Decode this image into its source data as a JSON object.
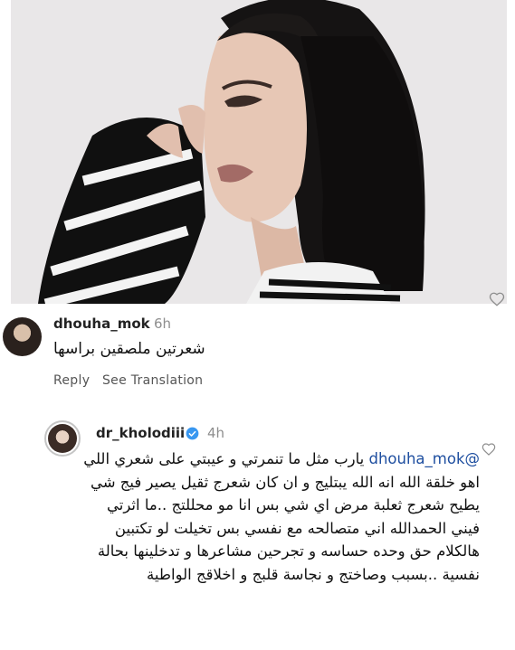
{
  "post": {
    "image_alt": "portrait photo",
    "heart_icon": "heart-outline-icon"
  },
  "comment1": {
    "username": "dhouha_mok",
    "time": "6h",
    "text": "شعرتين ملصقين براسها",
    "reply_label": "Reply",
    "see_translation_label": "See Translation"
  },
  "comment2": {
    "username": "dr_kholodiii",
    "verified_icon": "verified-badge-icon",
    "time": "4h",
    "mention": "@dhouha_mok",
    "text": "يارب مثل ما تنمرتي و عيبتي على شعري اللي اهو خلقة الله  انه الله يبتليج و ان كان شعرج ثقيل يصير فيج شي يطيح شعرج ثعلبة مرض اي شي بس انا مو محللتج ..ما اثرتي فيني الحمدالله اني متصالحه مع نفسي بس تخيلت لو تكتبين هالكلام حق وحده حساسه و تجرحين مشاعرها و تدخلينها بحالة نفسية ..بسبب وصاختج و نجاسة قلبج و اخلاقج الواطية",
    "heart_icon": "heart-outline-icon"
  },
  "colors": {
    "mention": "#1f4fa0",
    "verified": "#3897f0",
    "meta_gray": "#8e8e8e"
  }
}
